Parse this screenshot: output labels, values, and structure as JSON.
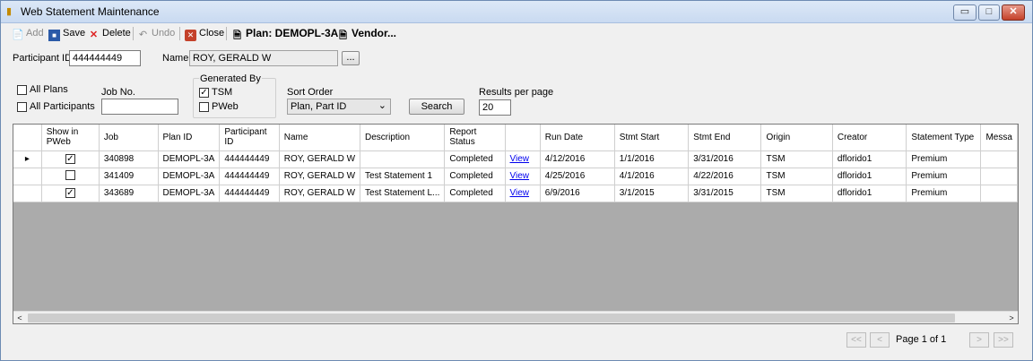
{
  "window": {
    "title": "Web Statement Maintenance",
    "minimize": "▭",
    "maximize": "□",
    "close": "✕"
  },
  "toolbar": {
    "add": "Add",
    "save": "Save",
    "delete": "Delete",
    "undo": "Undo",
    "close": "Close",
    "plan": "Plan: DEMOPL-3A",
    "vendor": "Vendor..."
  },
  "form": {
    "participant_id_label": "Participant ID",
    "participant_id": "444444449",
    "name_label": "Name",
    "name": "ROY, GERALD W",
    "name_btn": "...",
    "all_plans": "All Plans",
    "all_participants": "All Participants",
    "job_no_label": "Job No.",
    "job_no": "",
    "generated_by_label": "Generated By",
    "tsm": "TSM",
    "pweb": "PWeb",
    "sort_order_label": "Sort Order",
    "sort_order": "Plan, Part ID",
    "search_btn": "Search",
    "results_label": "Results per page",
    "results": "20"
  },
  "grid": {
    "columns": [
      "",
      "Show in PWeb",
      "Job",
      "Plan ID",
      "Participant ID",
      "Name",
      "Description",
      "Report Status",
      "",
      "Run Date",
      "Stmt Start",
      "Stmt End",
      "Origin",
      "Creator",
      "Statement Type",
      "Messa"
    ],
    "rows": [
      {
        "selector": "▸",
        "show": "✓",
        "job": "340898",
        "plan": "DEMOPL-3A",
        "participant": "444444449",
        "name": "ROY, GERALD W",
        "description": "",
        "status": "Completed",
        "view": "View",
        "run_date": "4/12/2016",
        "start": "1/1/2016",
        "end": "3/31/2016",
        "origin": "TSM",
        "creator": "dflorido1",
        "type": "Premium",
        "message": ""
      },
      {
        "selector": "",
        "show": "",
        "job": "341409",
        "plan": "DEMOPL-3A",
        "participant": "444444449",
        "name": "ROY, GERALD W",
        "description": "Test Statement 1",
        "status": "Completed",
        "view": "View",
        "run_date": "4/25/2016",
        "start": "4/1/2016",
        "end": "4/22/2016",
        "origin": "TSM",
        "creator": "dflorido1",
        "type": "Premium",
        "message": ""
      },
      {
        "selector": "",
        "show": "✓",
        "job": "343689",
        "plan": "DEMOPL-3A",
        "participant": "444444449",
        "name": "ROY, GERALD W",
        "description": "Test Statement L...",
        "status": "Completed",
        "view": "View",
        "run_date": "6/9/2016",
        "start": "3/1/2015",
        "end": "3/31/2015",
        "origin": "TSM",
        "creator": "dflorido1",
        "type": "Premium",
        "message": ""
      }
    ]
  },
  "pager": {
    "first": "<<",
    "prev": "<",
    "page_text": "Page 1 of 1",
    "next": ">",
    "last": ">>"
  },
  "scroll": {
    "left": "<",
    "right": ">"
  },
  "icons": {
    "app": "app-icon",
    "add": "add-icon",
    "save": "save-icon",
    "delete": "delete-icon",
    "undo": "undo-icon",
    "close": "close-icon",
    "plan": "document-icon",
    "vendor": "document-icon"
  },
  "colors": {
    "title_bar": "#c9daf1",
    "grid_empty": "#ababab",
    "close_red": "#c4412a",
    "link": "#0000ee"
  }
}
